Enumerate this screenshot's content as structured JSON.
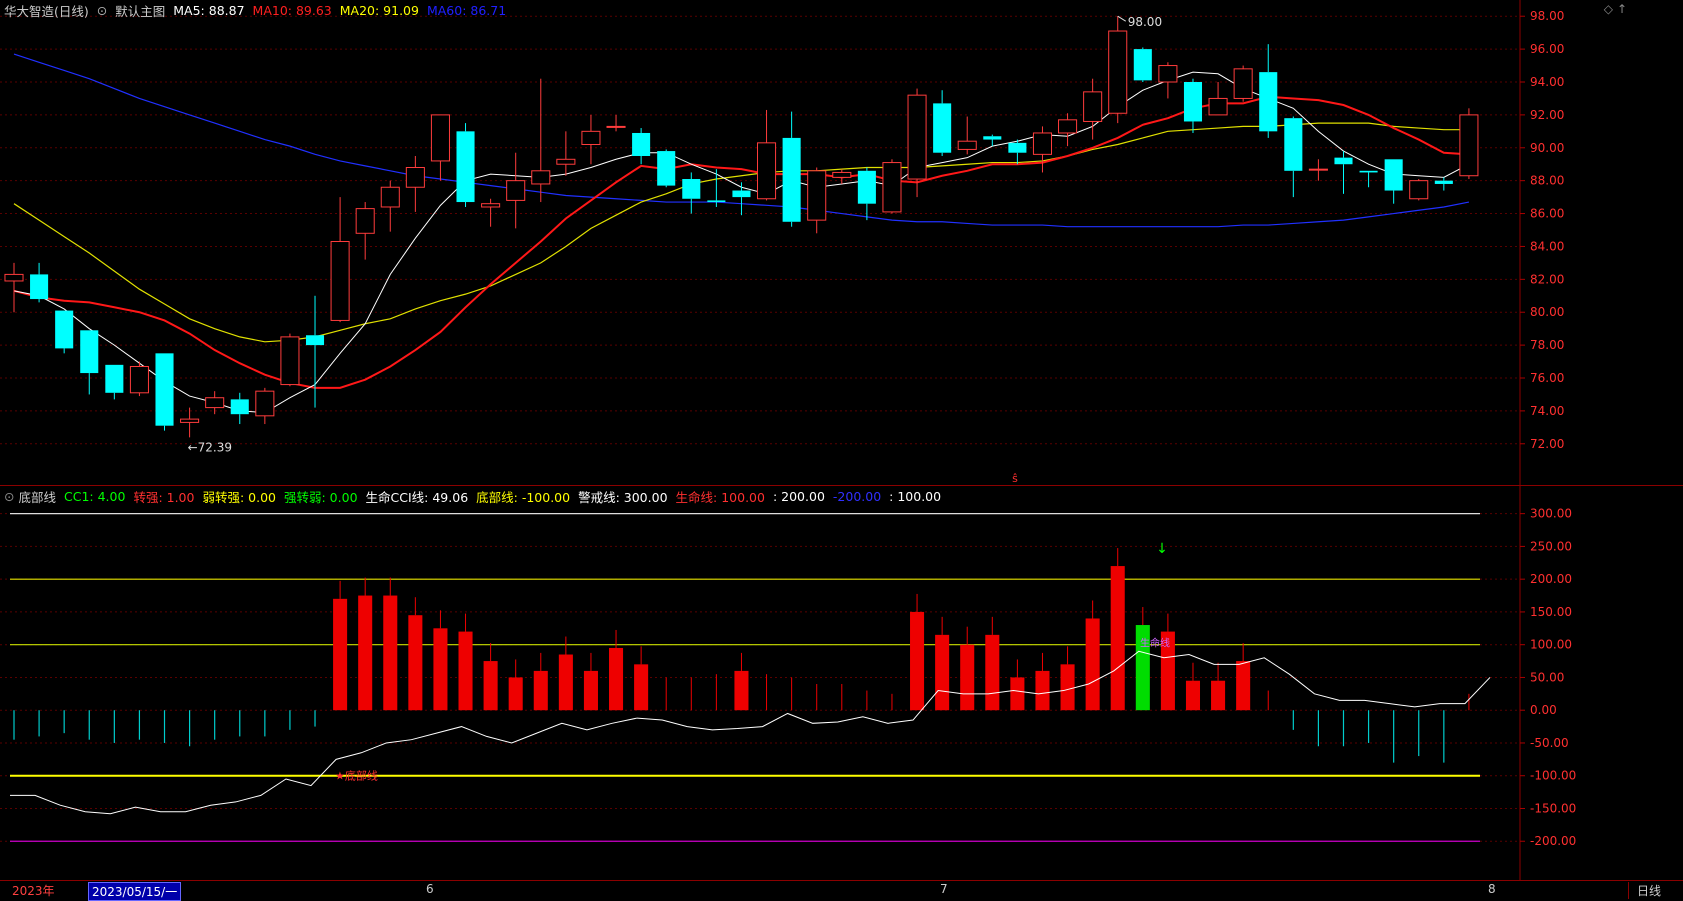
{
  "main_header": {
    "stock_name": "华大智造(日线)",
    "chart_name": "默认主图",
    "ma5": "MA5: 88.87",
    "ma10": "MA10: 89.63",
    "ma20": "MA20: 91.09",
    "ma60": "MA60: 86.71"
  },
  "ind_header": {
    "name": "底部线",
    "items": [
      {
        "text": "CC1: 4.00",
        "color": "#00ff00"
      },
      {
        "text": "转强: 1.00",
        "color": "#ff3030"
      },
      {
        "text": "弱转强: 0.00",
        "color": "#ffff00"
      },
      {
        "text": "强转弱: 0.00",
        "color": "#00ff00"
      },
      {
        "text": "生命CCI线: 49.06",
        "color": "#ffffff"
      },
      {
        "text": "底部线: -100.00",
        "color": "#ffff00"
      },
      {
        "text": "警戒线: 300.00",
        "color": "#ffffff"
      },
      {
        "text": "生命线: 100.00",
        "color": "#ff3030"
      },
      {
        "text": ": 200.00",
        "color": "#ffffff"
      },
      {
        "text": "-200.00",
        "color": "#3030ff"
      },
      {
        "text": ": 100.00",
        "color": "#ffffff"
      }
    ]
  },
  "price_axis": [
    "98.00",
    "96.00",
    "94.00",
    "92.00",
    "90.00",
    "88.00",
    "86.00",
    "84.00",
    "82.00",
    "80.00",
    "78.00",
    "76.00",
    "74.00",
    "72.00"
  ],
  "ind_axis": [
    "300.00",
    "250.00",
    "200.00",
    "150.00",
    "100.00",
    "50.00",
    "0.00",
    "-50.00",
    "-100.00",
    "-150.00",
    "-200.00"
  ],
  "annotations": {
    "high": "98.00",
    "low": "72.39",
    "bottom_label": "底部线",
    "cross_label": "生命线"
  },
  "time_axis": {
    "year": "2023年",
    "cursor_date": "2023/05/15/一",
    "m6": "6",
    "m7": "7",
    "m8": "8",
    "period": "日线"
  },
  "chart_data": {
    "type": "candlestick",
    "ylim": [
      71.5,
      98.5
    ],
    "candles": [
      [
        81.9,
        82.3,
        83.0,
        80.0
      ],
      [
        82.3,
        80.8,
        83.0,
        80.6
      ],
      [
        80.1,
        77.8,
        80.1,
        77.5
      ],
      [
        78.9,
        76.3,
        78.9,
        75.0
      ],
      [
        76.8,
        75.1,
        76.8,
        74.7
      ],
      [
        75.1,
        76.7,
        77.0,
        74.9
      ],
      [
        77.5,
        73.1,
        77.5,
        72.8
      ],
      [
        73.3,
        73.5,
        74.2,
        72.39
      ],
      [
        74.2,
        74.8,
        75.2,
        73.8
      ],
      [
        74.7,
        73.8,
        75.1,
        73.2
      ],
      [
        73.7,
        75.2,
        75.4,
        73.2
      ],
      [
        75.6,
        78.5,
        78.7,
        75.5
      ],
      [
        78.6,
        78.0,
        81.0,
        74.2
      ],
      [
        79.5,
        84.3,
        87.0,
        79.4
      ],
      [
        84.8,
        86.3,
        86.7,
        83.2
      ],
      [
        86.4,
        87.6,
        88.0,
        84.9
      ],
      [
        87.6,
        88.8,
        89.5,
        86.1
      ],
      [
        89.2,
        92.0,
        92.0,
        88.0
      ],
      [
        91.0,
        86.7,
        91.5,
        86.4
      ],
      [
        86.4,
        86.6,
        86.9,
        85.2
      ],
      [
        86.8,
        88.0,
        89.7,
        85.1
      ],
      [
        87.8,
        88.6,
        94.2,
        86.7
      ],
      [
        89.0,
        89.3,
        91.0,
        88.3
      ],
      [
        90.2,
        91.0,
        92.0,
        89.0
      ],
      [
        91.3,
        91.3,
        92.0,
        91.0
      ],
      [
        90.9,
        89.5,
        91.2,
        89.0
      ],
      [
        89.8,
        87.7,
        89.9,
        87.6
      ],
      [
        88.1,
        86.9,
        88.5,
        86.0
      ],
      [
        86.8,
        86.7,
        88.7,
        86.4
      ],
      [
        87.4,
        87.0,
        87.9,
        85.9
      ],
      [
        86.9,
        90.3,
        92.3,
        86.8
      ],
      [
        90.6,
        85.5,
        92.2,
        85.2
      ],
      [
        85.6,
        88.6,
        88.8,
        84.8
      ],
      [
        88.2,
        88.5,
        88.7,
        87.8
      ],
      [
        88.6,
        86.6,
        88.8,
        85.6
      ],
      [
        86.1,
        89.1,
        89.3,
        86.0
      ],
      [
        88.1,
        93.2,
        93.6,
        87.0
      ],
      [
        92.7,
        89.7,
        93.5,
        89.5
      ],
      [
        89.9,
        90.4,
        91.9,
        89.6
      ],
      [
        90.7,
        90.5,
        90.8,
        90.1
      ],
      [
        90.3,
        89.7,
        90.5,
        89.0
      ],
      [
        89.6,
        90.9,
        91.3,
        88.5
      ],
      [
        90.9,
        91.7,
        92.1,
        90.1
      ],
      [
        91.6,
        93.4,
        94.2,
        90.5
      ],
      [
        92.1,
        97.1,
        98.0,
        91.5
      ],
      [
        96.0,
        94.1,
        96.1,
        94.0
      ],
      [
        94.0,
        95.0,
        95.2,
        93.0
      ],
      [
        94.0,
        91.6,
        94.2,
        90.9
      ],
      [
        92.0,
        93.0,
        94.0,
        92.0
      ],
      [
        93.0,
        94.8,
        95.0,
        92.8
      ],
      [
        94.6,
        91.0,
        96.3,
        90.6
      ],
      [
        91.8,
        88.6,
        91.9,
        87.0
      ],
      [
        88.7,
        88.7,
        89.3,
        88.0
      ],
      [
        89.4,
        89.0,
        89.8,
        87.2
      ],
      [
        88.6,
        88.5,
        88.6,
        87.6
      ],
      [
        89.3,
        87.4,
        89.3,
        86.6
      ],
      [
        86.9,
        88.0,
        88.1,
        86.8
      ],
      [
        88.0,
        87.8,
        88.2,
        87.4
      ],
      [
        88.3,
        92.0,
        92.4,
        88.1
      ]
    ],
    "ma5": [
      81.3,
      81.0,
      80.2,
      79.0,
      78.0,
      76.9,
      75.8,
      74.9,
      74.5,
      74.0,
      73.9,
      74.8,
      75.6,
      77.5,
      79.3,
      82.3,
      84.5,
      86.5,
      88.0,
      88.4,
      88.3,
      88.2,
      88.4,
      88.8,
      89.3,
      89.7,
      89.7,
      89.0,
      88.4,
      87.6,
      87.2,
      88.0,
      87.6,
      87.8,
      88.0,
      87.7,
      88.8,
      89.1,
      89.4,
      90.1,
      90.4,
      90.8,
      90.7,
      91.3,
      92.5,
      93.5,
      94.1,
      94.6,
      94.5,
      93.6,
      93.0,
      92.4,
      91.0,
      89.8,
      89.0,
      88.4,
      88.3,
      88.2,
      89.0
    ],
    "ma10": [
      81.3,
      80.9,
      80.7,
      80.6,
      80.3,
      80.0,
      79.5,
      78.7,
      77.7,
      76.9,
      76.2,
      75.7,
      75.4,
      75.4,
      75.9,
      76.7,
      77.7,
      78.8,
      80.3,
      81.7,
      83.0,
      84.3,
      85.7,
      86.8,
      87.9,
      88.9,
      88.7,
      89.0,
      88.8,
      88.7,
      88.4,
      88.4,
      88.4,
      88.2,
      88.4,
      88.0,
      87.9,
      88.3,
      88.6,
      89.0,
      89.0,
      89.1,
      89.5,
      90.0,
      90.6,
      91.4,
      91.8,
      92.4,
      92.7,
      92.7,
      93.1,
      93.0,
      92.9,
      92.6,
      92.0,
      91.2,
      90.5,
      89.7,
      89.6
    ],
    "ma20": [
      86.6,
      85.6,
      84.6,
      83.6,
      82.5,
      81.4,
      80.5,
      79.6,
      79.0,
      78.5,
      78.2,
      78.3,
      78.5,
      78.9,
      79.3,
      79.6,
      80.2,
      80.7,
      81.1,
      81.6,
      82.3,
      83.0,
      84.0,
      85.1,
      85.9,
      86.7,
      87.2,
      87.8,
      88.1,
      88.3,
      88.5,
      88.6,
      88.6,
      88.7,
      88.8,
      88.8,
      88.8,
      88.9,
      89.0,
      89.1,
      89.1,
      89.2,
      89.5,
      89.9,
      90.2,
      90.6,
      91.0,
      91.1,
      91.2,
      91.3,
      91.3,
      91.4,
      91.5,
      91.5,
      91.5,
      91.3,
      91.2,
      91.1,
      91.1
    ],
    "ma60": [
      95.7,
      95.2,
      94.7,
      94.2,
      93.6,
      93.0,
      92.5,
      92.0,
      91.5,
      91.0,
      90.5,
      90.1,
      89.6,
      89.2,
      88.9,
      88.6,
      88.3,
      88.1,
      87.9,
      87.7,
      87.5,
      87.3,
      87.1,
      87.0,
      86.9,
      86.8,
      86.7,
      86.7,
      86.7,
      86.6,
      86.5,
      86.4,
      86.2,
      86.0,
      85.8,
      85.6,
      85.5,
      85.5,
      85.4,
      85.3,
      85.3,
      85.3,
      85.2,
      85.2,
      85.2,
      85.2,
      85.2,
      85.2,
      85.2,
      85.3,
      85.3,
      85.4,
      85.5,
      85.6,
      85.8,
      86.0,
      86.2,
      86.4,
      86.7
    ],
    "cci_ylim": [
      -250,
      330
    ],
    "cci_bars": [
      -45,
      -40,
      -35,
      -45,
      -50,
      -45,
      -50,
      -55,
      -45,
      -40,
      -40,
      -30,
      -25,
      170,
      175,
      175,
      145,
      125,
      120,
      75,
      50,
      60,
      85,
      60,
      95,
      70,
      30,
      30,
      35,
      60,
      35,
      30,
      20,
      20,
      10,
      5,
      150,
      115,
      100,
      115,
      50,
      60,
      70,
      140,
      220,
      130,
      120,
      45,
      45,
      75,
      10,
      -30,
      -55,
      -55,
      -50,
      -80,
      -70,
      -80,
      5
    ],
    "cci_bar_colors": [
      "c",
      "c",
      "c",
      "c",
      "c",
      "c",
      "c",
      "c",
      "c",
      "c",
      "c",
      "c",
      "c",
      "r",
      "r",
      "r",
      "r",
      "r",
      "r",
      "r",
      "r",
      "r",
      "r",
      "r",
      "r",
      "r",
      "r",
      "r",
      "r",
      "r",
      "r",
      "r",
      "r",
      "r",
      "r",
      "r",
      "r",
      "r",
      "r",
      "r",
      "r",
      "r",
      "r",
      "r",
      "r",
      "g",
      "r",
      "r",
      "r",
      "r",
      "r",
      "c",
      "c",
      "c",
      "c",
      "c",
      "c",
      "c",
      "r"
    ],
    "cci_line": [
      -130,
      -130,
      -145,
      -155,
      -158,
      -148,
      -155,
      -155,
      -145,
      -140,
      -130,
      -105,
      -115,
      -75,
      -65,
      -50,
      -45,
      -35,
      -25,
      -40,
      -50,
      -35,
      -20,
      -30,
      -20,
      -12,
      -15,
      -25,
      -30,
      -28,
      -25,
      -5,
      -20,
      -18,
      -10,
      -20,
      -15,
      30,
      25,
      25,
      30,
      25,
      30,
      40,
      60,
      90,
      80,
      85,
      70,
      70,
      80,
      55,
      25,
      15,
      15,
      10,
      5,
      10,
      10,
      50
    ],
    "ref_lines": [
      300,
      200,
      100,
      -100,
      -200
    ]
  }
}
